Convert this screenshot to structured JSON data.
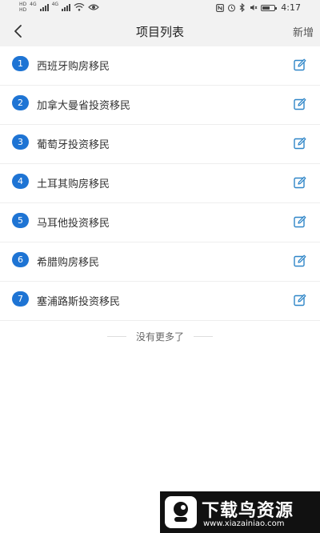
{
  "status_bar": {
    "badge_top": "HD",
    "badge_bottom": "HD",
    "net_1": "4G",
    "net_2": "4G",
    "time": "4:17",
    "battery_level": 0.65,
    "icons": [
      "signal-icon",
      "wifi-icon",
      "eye-icon",
      "nfc-icon",
      "alarm-icon",
      "bluetooth-icon",
      "mute-icon",
      "battery-icon"
    ]
  },
  "nav": {
    "back_icon": "chevron-left-icon",
    "title": "项目列表",
    "action_label": "新增"
  },
  "items": [
    {
      "number": "1",
      "label": "西班牙购房移民"
    },
    {
      "number": "2",
      "label": "加拿大曼省投资移民"
    },
    {
      "number": "3",
      "label": "葡萄牙投资移民"
    },
    {
      "number": "4",
      "label": "土耳其购房移民"
    },
    {
      "number": "5",
      "label": "马耳他投资移民"
    },
    {
      "number": "6",
      "label": "希腊购房移民"
    },
    {
      "number": "7",
      "label": "塞浦路斯投资移民"
    }
  ],
  "end_note": "没有更多了",
  "watermark": {
    "title": "下载鸟资源",
    "url": "www.xiazainiao.com"
  },
  "colors": {
    "accent": "#1e74d4",
    "edit_icon": "#2f86c8",
    "bar_bg": "#f2f2f2"
  }
}
